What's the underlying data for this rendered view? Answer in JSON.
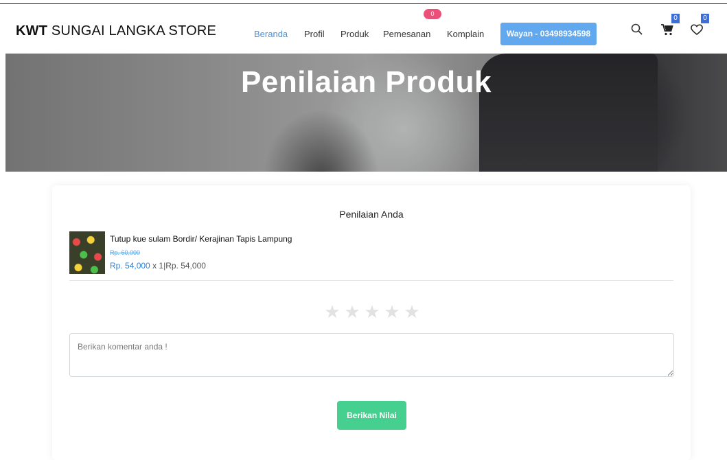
{
  "brand": {
    "bold": "KWT",
    "rest": " SUNGAI LANGKA STORE"
  },
  "nav": {
    "items": [
      "Beranda",
      "Profil",
      "Produk",
      "Pemesanan",
      "Komplain"
    ],
    "orders_badge": "0"
  },
  "user_button": "Wayan - 03498934598",
  "cart_count": "0",
  "wishlist_count": "0",
  "hero_title": "Penilaian Produk",
  "rating": {
    "section_title": "Penilaian Anda",
    "product_name": "Tutup kue sulam Bordir/ Kerajinan Tapis Lampung",
    "old_price": "Rp. 60,000",
    "price": "Rp. 54,000",
    "qty": "x 1",
    "divider": "|",
    "subtotal": "Rp. 54,000",
    "stars_total": 5,
    "stars_selected": 0,
    "comment_placeholder": "Berikan komentar anda !",
    "submit_label": "Berikan Nilai"
  },
  "colors": {
    "accent": "#62a8ef",
    "badge": "#ec4f79",
    "submit": "#45d08f"
  }
}
